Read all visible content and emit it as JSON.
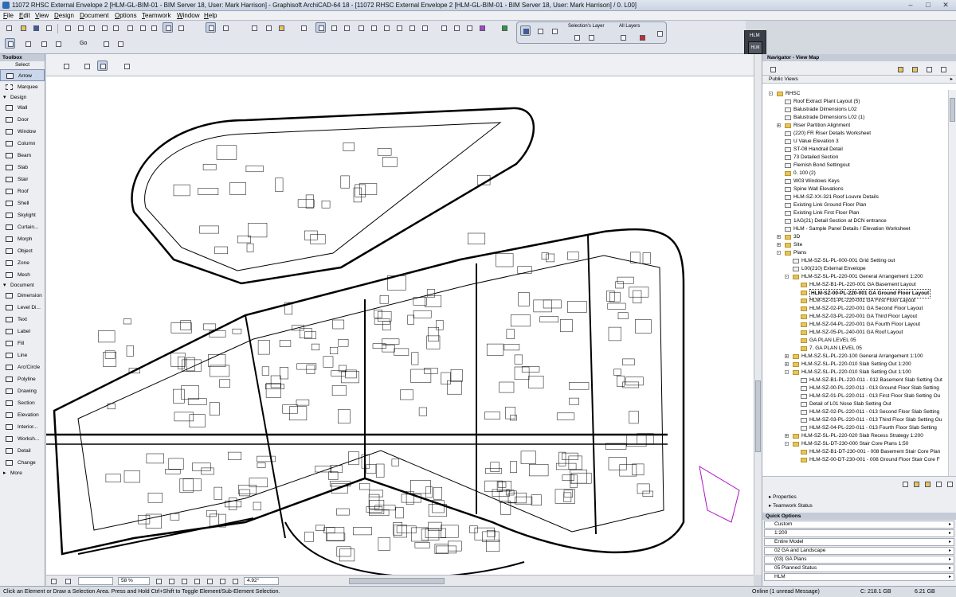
{
  "window": {
    "title": "11072 RHSC External Envelope 2 [HLM-GL-BIM-01 - BIM Server 18, User: Mark Harrison] - Graphisoft ArchiCAD-64 18 - [11072 RHSC External Envelope 2 [HLM-GL-BIM-01 - BIM Server 18, User: Mark Harrison] / 0. L00]",
    "controls": {
      "minimize": "–",
      "maximize": "□",
      "close": "✕"
    }
  },
  "menubar": [
    "File",
    "Edit",
    "View",
    "Design",
    "Document",
    "Options",
    "Teamwork",
    "Window",
    "Help"
  ],
  "toolbar": {
    "go_label": "Go",
    "layers": {
      "selection_label": "Selection's Layer",
      "all_label": "All Layers"
    }
  },
  "hlm_badge": {
    "label": "HLM",
    "logo": "HLM"
  },
  "toolbox": {
    "title": "Toolbox",
    "select_label": "Select",
    "select_tools": [
      "Arrow",
      "Marquee"
    ],
    "design_label": "Design",
    "design_tools": [
      "Wall",
      "Door",
      "Window",
      "Column",
      "Beam",
      "Slab",
      "Stair",
      "Roof",
      "Shell",
      "Skylight",
      "Curtain...",
      "Morph",
      "Object",
      "Zone",
      "Mesh"
    ],
    "document_label": "Document",
    "document_tools": [
      "Dimension",
      "Level Di...",
      "Text",
      "Label",
      "Fill",
      "Line",
      "Arc/Circle",
      "Polyline",
      "Drawing",
      "Section",
      "Elevation",
      "Interior...",
      "Worksh...",
      "Detail",
      "Change"
    ],
    "more_label": "More"
  },
  "scrollbar": {
    "zoom_percent": "58 %",
    "angle": "4.92°"
  },
  "status": {
    "hint": "Click an Element or Draw a Selection Area. Press and Hold Ctrl+Shift to Toggle Element/Sub-Element Selection.",
    "online": "Online (1 unread Message)",
    "disk_c": "C: 218.1 GB",
    "ram": "6.21 GB"
  },
  "navigator": {
    "title": "Navigator - View Map",
    "dropdown": "Public Views",
    "tree": [
      {
        "label": "RHSC",
        "level": 0,
        "type": "root",
        "toggle": "-"
      },
      {
        "label": "Roof Extract Plant Layout  (5)",
        "level": 1,
        "type": "view"
      },
      {
        "label": "Balustrade Dimensions L02",
        "level": 1,
        "type": "view"
      },
      {
        "label": "Balustrade Dimensions L02  (1)",
        "level": 1,
        "type": "view"
      },
      {
        "label": "Riser Partition Alignment",
        "level": 1,
        "type": "folder",
        "toggle": "+"
      },
      {
        "label": "(220) FR Riser Details Worksheet",
        "level": 1,
        "type": "view"
      },
      {
        "label": "U Value Elevation 3",
        "level": 1,
        "type": "view"
      },
      {
        "label": "ST-08 Handrail Detail",
        "level": 1,
        "type": "view"
      },
      {
        "label": "73 Detailed Section",
        "level": 1,
        "type": "view"
      },
      {
        "label": "Flemish Bond Settingout",
        "level": 1,
        "type": "view"
      },
      {
        "label": "0. 100 (2)",
        "level": 1,
        "type": "folder"
      },
      {
        "label": "W03 Windows Keys",
        "level": 1,
        "type": "view"
      },
      {
        "label": "Spine Wall Elevations",
        "level": 1,
        "type": "view"
      },
      {
        "label": "HLM-SZ-XX-321 Roof Louvre Details",
        "level": 1,
        "type": "view"
      },
      {
        "label": "Existing Link  Ground Floor Plan",
        "level": 1,
        "type": "view"
      },
      {
        "label": "Existing Link First Floor Plan",
        "level": 1,
        "type": "view"
      },
      {
        "label": "1AG(21) Detail Section at DCN entrance",
        "level": 1,
        "type": "view"
      },
      {
        "label": "HLM - Sample Panel Details / Elevation  Worksheet",
        "level": 1,
        "type": "view"
      },
      {
        "label": "3D",
        "level": 1,
        "type": "folder",
        "toggle": "+"
      },
      {
        "label": "Site",
        "level": 1,
        "type": "folder",
        "toggle": "+"
      },
      {
        "label": "Plans",
        "level": 1,
        "type": "folder",
        "toggle": "-"
      },
      {
        "label": "HLM-SZ-SL-PL-000-001 Grid Setting out",
        "level": 2,
        "type": "view"
      },
      {
        "label": "L00(210) External Envelope",
        "level": 2,
        "type": "view"
      },
      {
        "label": "HLM-SZ-SL-PL-220-001 General Arrangement 1:200",
        "level": 2,
        "type": "folder",
        "toggle": "-"
      },
      {
        "label": "HLM-SZ-B1-PL-220-001 GA Basement Layout",
        "level": 3,
        "type": "folder"
      },
      {
        "label": "HLM-SZ-00-PL-220-001 GA Ground Floor Layout",
        "level": 3,
        "type": "folder",
        "selected": true
      },
      {
        "label": "HLM-SZ-01-PL-220-001 GA First Floor Layout",
        "level": 3,
        "type": "folder"
      },
      {
        "label": "HLM-SZ-02-PL-220-001 GA Second Floor Layout",
        "level": 3,
        "type": "folder"
      },
      {
        "label": "HLM-SZ-03-PL-220-001 GA Third Floor Layout",
        "level": 3,
        "type": "folder"
      },
      {
        "label": "HLM-SZ-04-PL-220-001 GA Fourth Floor Layout",
        "level": 3,
        "type": "folder"
      },
      {
        "label": "HLM-SZ-05-PL-240-001 GA Roof Layout",
        "level": 3,
        "type": "folder"
      },
      {
        "label": "GA PLAN LEVEL 05",
        "level": 3,
        "type": "folder"
      },
      {
        "label": "7. GA PLAN LEVEL 05",
        "level": 3,
        "type": "folder"
      },
      {
        "label": "HLM-SZ-SL-PL-220-100 General Arrangement 1:100",
        "level": 2,
        "type": "folder",
        "toggle": "+"
      },
      {
        "label": "HLM-SZ-SL-PL-220-010 Slab Setting Out 1:200",
        "level": 2,
        "type": "folder",
        "toggle": "+"
      },
      {
        "label": "HLM-SZ-SL-PL-220-010 Slab Setting Out 1:100",
        "level": 2,
        "type": "folder",
        "toggle": "-"
      },
      {
        "label": "HLM-SZ-B1-PL-220-011 - 012 Basement Slab Setting Out",
        "level": 3,
        "type": "view"
      },
      {
        "label": "HLM-SZ-00-PL-220-011 - 013 Ground Floor Slab Setting",
        "level": 3,
        "type": "view"
      },
      {
        "label": "HLM-SZ-01-PL-220-011 - 013 First Floor Slab Setting Ou",
        "level": 3,
        "type": "view"
      },
      {
        "label": "Detail of L01 Nose Slab Setting Out",
        "level": 3,
        "type": "view"
      },
      {
        "label": "HLM-SZ-02-PL-220-011 - 013 Second Floor Slab Setting",
        "level": 3,
        "type": "view"
      },
      {
        "label": "HLM-SZ-03-PL-220-011 - 013 Third Floor Slab Setting Ou",
        "level": 3,
        "type": "view"
      },
      {
        "label": "HLM-SZ-04-PL-220-011 - 013 Fourth Floor Slab Setting",
        "level": 3,
        "type": "view"
      },
      {
        "label": "HLM-SZ-SL-PL-220-020 Slab Recess Strategy 1:200",
        "level": 2,
        "type": "folder",
        "toggle": "+"
      },
      {
        "label": "HLM-SZ-SL-DT-230-000 Stair Core Plans 1:50",
        "level": 2,
        "type": "folder",
        "toggle": "-"
      },
      {
        "label": "HLM-SZ-B1-DT-230-001 - 008 Basement Stair Core Plan",
        "level": 3,
        "type": "folder"
      },
      {
        "label": "HLM-SZ-00-DT-230-001 - 008 Ground Floor Stair Core F",
        "level": 3,
        "type": "folder"
      }
    ],
    "properties_label": "Properties",
    "teamwork_label": "Teamwork Status"
  },
  "quick_options": {
    "title": "Quick Options",
    "items": [
      "Custom",
      "1:200",
      "Entire Model",
      "02 GA and Landscape",
      "(03) GA Plans",
      "05 Planned Status",
      "HLM"
    ]
  }
}
